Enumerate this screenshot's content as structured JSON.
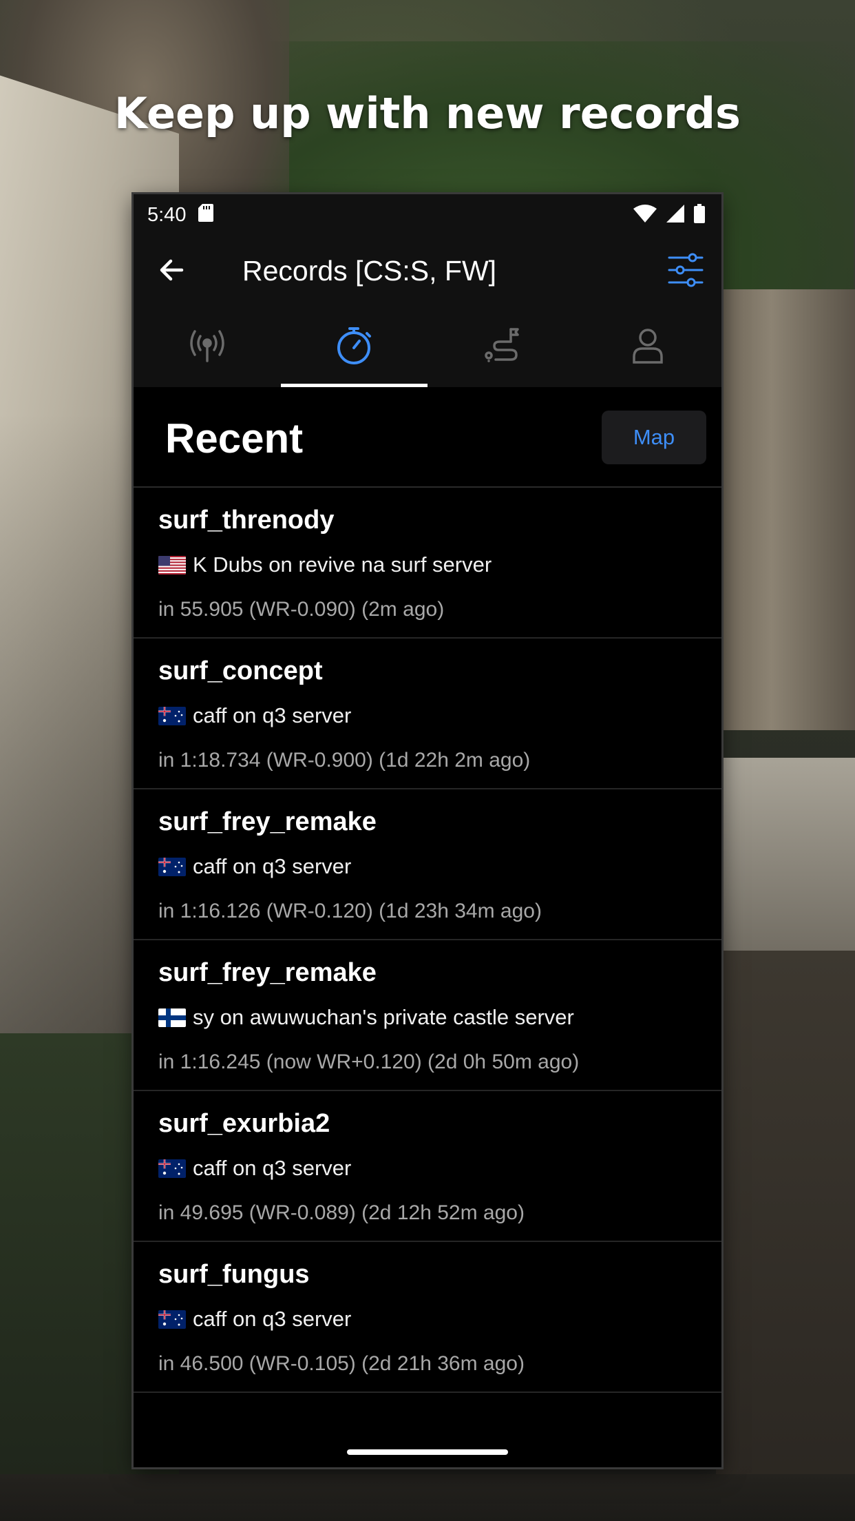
{
  "headline": "Keep up with new records",
  "status_bar": {
    "time": "5:40"
  },
  "app_bar": {
    "title": "Records [CS:S, FW]"
  },
  "tabs": [
    {
      "icon": "broadcast-icon",
      "active": false
    },
    {
      "icon": "stopwatch-icon",
      "active": true
    },
    {
      "icon": "route-icon",
      "active": false
    },
    {
      "icon": "person-icon",
      "active": false
    }
  ],
  "section": {
    "title": "Recent",
    "map_button": "Map"
  },
  "records": [
    {
      "map": "surf_threnody",
      "flag": "us-flag-icon",
      "player_line": "K Dubs on revive na surf server",
      "time_line": "in 55.905 (WR-0.090) (2m ago)"
    },
    {
      "map": "surf_concept",
      "flag": "au-flag-icon",
      "player_line": "caff on q3 server",
      "time_line": "in 1:18.734 (WR-0.900) (1d 22h 2m ago)"
    },
    {
      "map": "surf_frey_remake",
      "flag": "au-flag-icon",
      "player_line": "caff on q3 server",
      "time_line": "in 1:16.126 (WR-0.120) (1d 23h 34m ago)"
    },
    {
      "map": "surf_frey_remake",
      "flag": "fi-flag-icon",
      "player_line": "sy on awuwuchan's private castle server",
      "time_line": "in 1:16.245 (now WR+0.120) (2d 0h 50m ago)"
    },
    {
      "map": "surf_exurbia2",
      "flag": "au-flag-icon",
      "player_line": "caff on q3 server",
      "time_line": "in 49.695 (WR-0.089) (2d 12h 52m ago)"
    },
    {
      "map": "surf_fungus",
      "flag": "au-flag-icon",
      "player_line": "caff on q3 server",
      "time_line": "in 46.500 (WR-0.105) (2d 21h 36m ago)"
    }
  ],
  "colors": {
    "accent": "#3e8ef7",
    "surface": "#111111",
    "background": "#000000",
    "secondary_text": "#a8a8a8"
  }
}
